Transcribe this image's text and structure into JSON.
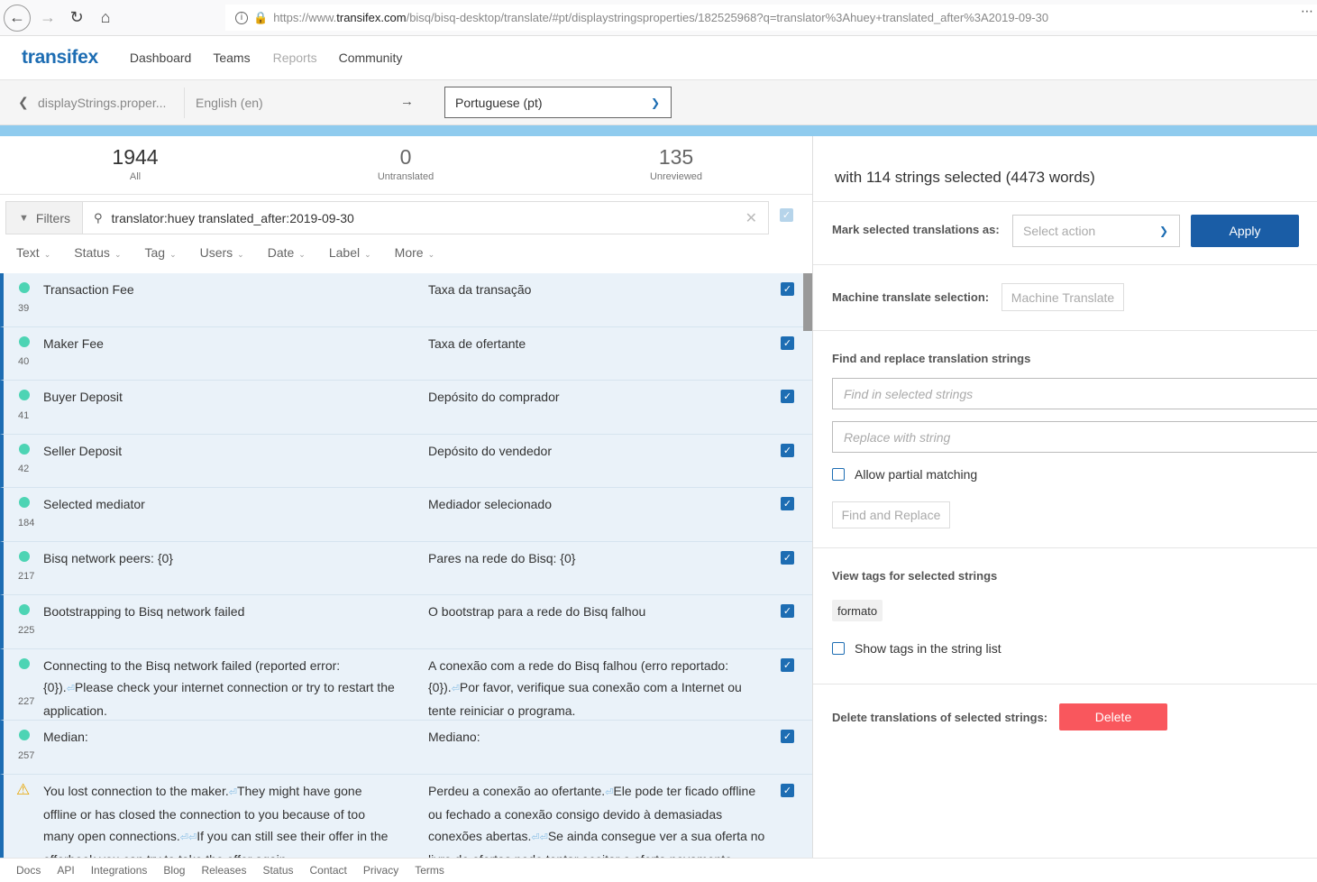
{
  "browser": {
    "url_prefix": "https://www.",
    "url_domain": "transifex.com",
    "url_rest": "/bisq/bisq-desktop/translate/#pt/displaystringsproperties/182525968?q=translator%3Ahuey+translated_after%3A2019-09-30"
  },
  "header": {
    "logo": "transifex",
    "nav": [
      "Dashboard",
      "Teams",
      "Reports",
      "Community"
    ]
  },
  "resource": {
    "name": "displayStrings.proper...",
    "source_lang": "English (en)",
    "arrow": "→",
    "target_lang": "Portuguese (pt)"
  },
  "stats": [
    {
      "value": "1944",
      "label": "All"
    },
    {
      "value": "0",
      "label": "Untranslated"
    },
    {
      "value": "135",
      "label": "Unreviewed"
    }
  ],
  "filter": {
    "button_label": "Filters",
    "query": "translator:huey translated_after:2019-09-30"
  },
  "column_filters": [
    "Text",
    "Status",
    "Tag",
    "Users",
    "Date",
    "Label",
    "More"
  ],
  "rows": [
    {
      "status": "translated",
      "source": "Transaction Fee",
      "target": "Taxa da transação",
      "number": "39",
      "height": 60
    },
    {
      "status": "translated",
      "source": "Maker Fee",
      "target": "Taxa de ofertante",
      "number": "40",
      "height": 59
    },
    {
      "status": "translated",
      "source": "Buyer Deposit",
      "target": "Depósito do comprador",
      "number": "41",
      "height": 60
    },
    {
      "status": "translated",
      "source": "Seller Deposit",
      "target": "Depósito do vendedor",
      "number": "42",
      "height": 59
    },
    {
      "status": "translated",
      "source": "Selected mediator",
      "target": "Mediador selecionado",
      "number": "184",
      "height": 60
    },
    {
      "status": "translated",
      "source": "Bisq network peers: {0}",
      "target": "Pares na rede do Bisq: {0}",
      "number": "217",
      "height": 59
    },
    {
      "status": "translated",
      "source": "Bootstrapping to Bisq network failed",
      "target": "O bootstrap para a rede do Bisq falhou",
      "number": "225",
      "height": 60
    },
    {
      "status": "translated",
      "source_parts": [
        "Connecting to the Bisq network failed (reported error: {0}).",
        "Please check your internet connection or try to restart the application."
      ],
      "target_parts": [
        "A conexão com a rede do Bisq falhou (erro reportado: {0}).",
        "Por favor, verifique sua conexão com a Internet ou tente reiniciar o programa."
      ],
      "number": "227",
      "height": 79
    },
    {
      "status": "translated",
      "source": "Median:",
      "target": "Mediano:",
      "number": "257",
      "height": 60
    },
    {
      "status": "warning",
      "source_parts": [
        "You lost connection to the maker.",
        "They might have gone offline or has closed the connection to you because of too many open connections.",
        "",
        "If you can still see their offer in the offerbook you can try to take the offer again."
      ],
      "target_parts": [
        "Perdeu a conexão ao ofertante.",
        "Ele pode ter ficado offline ou fechado a conexão consigo devido à demasiadas conexões abertas.",
        "",
        "Se ainda consegue ver a sua oferta no livro de ofertas pode tentar aceitar a oferta novamente."
      ],
      "number": "",
      "height": 100
    }
  ],
  "right": {
    "selection_heading": "with 114 strings selected (4473 words)",
    "mark_label": "Mark selected translations as:",
    "action_placeholder": "Select action",
    "apply_label": "Apply",
    "mt_label": "Machine translate selection:",
    "mt_button": "Machine Translate",
    "find_replace_heading": "Find and replace translation strings",
    "find_placeholder": "Find in selected strings",
    "replace_placeholder": "Replace with string",
    "partial_label": "Allow partial matching",
    "find_replace_button": "Find and Replace",
    "tags_heading": "View tags for selected strings",
    "tag": "formato",
    "show_tags_label": "Show tags in the string list",
    "delete_label": "Delete translations of selected strings:",
    "delete_button": "Delete"
  },
  "footer": [
    "Docs",
    "API",
    "Integrations",
    "Blog",
    "Releases",
    "Status",
    "Contact",
    "Privacy",
    "Terms"
  ],
  "colors": {
    "accent": "#1d6db3",
    "translated_dot": "#4dd4b4",
    "delete": "#f9575d",
    "apply": "#1a5da6"
  }
}
